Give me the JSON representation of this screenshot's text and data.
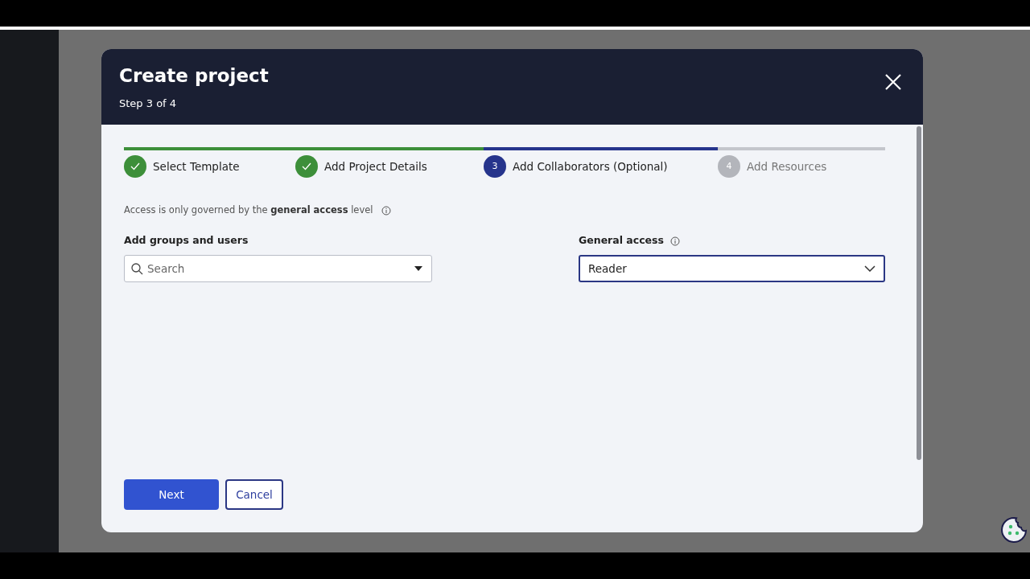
{
  "dialog": {
    "title": "Create project",
    "subtitle": "Step 3 of 4"
  },
  "steps": [
    {
      "label": "Select Template",
      "done": true,
      "selected": false
    },
    {
      "label": "Add Project Details",
      "done": true,
      "selected": false
    },
    {
      "label": "Add Collaborators (Optional)",
      "done": false,
      "selected": true,
      "number": "3"
    },
    {
      "label": "Add Resources",
      "done": false,
      "selected": false,
      "number": "4"
    }
  ],
  "note": "Access is only governed by the **general access** level",
  "groups_field": {
    "label": "Add groups and users",
    "placeholder": "Search"
  },
  "general_access": {
    "label": "General access",
    "value": "Reader"
  },
  "buttons": [
    {
      "label": "Next",
      "kind": "primary"
    },
    {
      "label": "Cancel",
      "kind": "secondary"
    }
  ]
}
